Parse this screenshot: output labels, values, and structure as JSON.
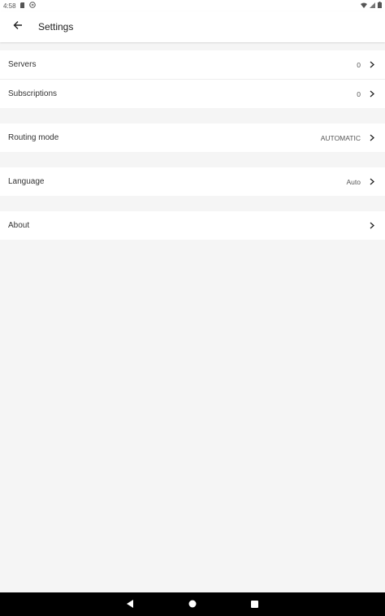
{
  "status_bar": {
    "time": "4:58",
    "icons": [
      "sd-card-icon",
      "vpn-key-icon",
      "wifi-icon",
      "signal-icon",
      "battery-icon"
    ]
  },
  "app_bar": {
    "title": "Settings",
    "back_icon": "arrow-back-icon"
  },
  "sections": [
    {
      "items": [
        {
          "label": "Servers",
          "value": "0"
        },
        {
          "label": "Subscriptions",
          "value": "0"
        }
      ]
    },
    {
      "items": [
        {
          "label": "Routing mode",
          "value": "AUTOMATIC"
        }
      ]
    },
    {
      "items": [
        {
          "label": "Language",
          "value": "Auto"
        }
      ]
    },
    {
      "items": [
        {
          "label": "About",
          "value": ""
        }
      ]
    }
  ],
  "nav_bar": {
    "buttons": [
      "back-triangle-icon",
      "home-circle-icon",
      "recents-square-icon"
    ]
  },
  "colors": {
    "background": "#f5f5f5",
    "surface": "#ffffff",
    "nav_bar": "#000000"
  }
}
